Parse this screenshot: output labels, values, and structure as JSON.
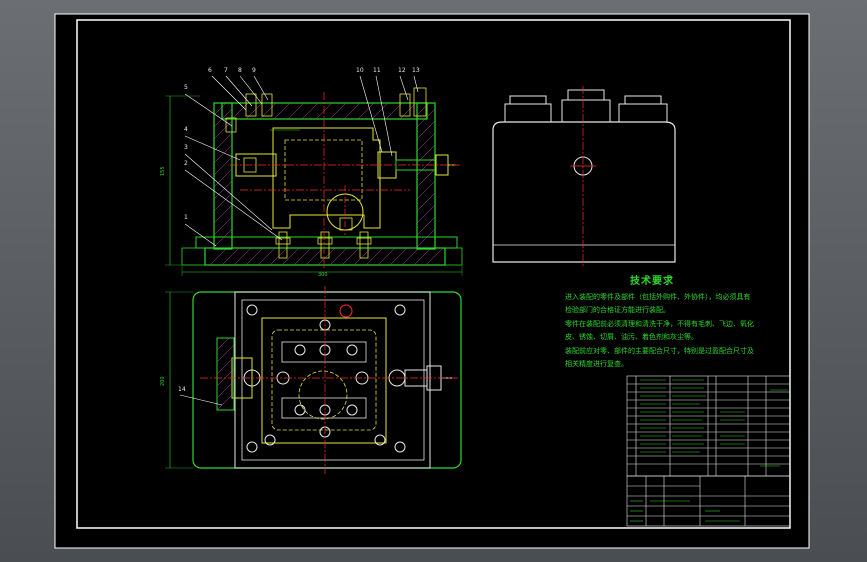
{
  "drawing": {
    "tech_requirements_title": "技术要求",
    "tech_requirements_lines": [
      "进入装配的零件及部件（包括外购件、外协件），均必须具有",
      "检验部门的合格证方能进行装配。",
      "零件在装配前必须清理和清洗干净，不得有毛刺、飞边、氧化",
      "皮、锈蚀、切屑、油污、着色剂和灰尘等。",
      "装配前应对零、部件的主要配合尺寸，特别是过盈配合尺寸及",
      "相关精度进行复查。"
    ],
    "balloon_numbers_top": [
      "6",
      "7",
      "8",
      "9",
      "10",
      "11",
      "12",
      "13"
    ],
    "balloon_numbers_left": [
      "5",
      "4",
      "3",
      "2",
      "1"
    ],
    "balloon_number_plan": "14",
    "dim_front_width": "300",
    "dim_front_height": "155",
    "dim_plan_height": "200",
    "colors": {
      "green": "#2bd92b",
      "yellow": "#e6e632",
      "red": "#ff2a2a",
      "white": "#e8e8e8",
      "magenta": "#d03ad0",
      "cyan": "#2ad8d8"
    }
  }
}
